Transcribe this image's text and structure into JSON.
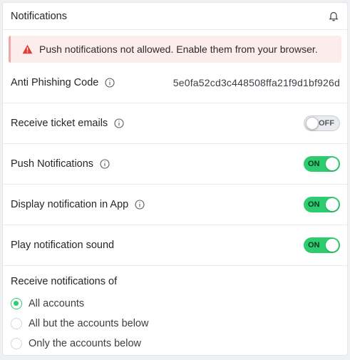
{
  "header": {
    "title": "Notifications",
    "icon": "bell-icon"
  },
  "alert": {
    "text": "Push notifications not allowed. Enable them from your browser.",
    "color": "#e53935"
  },
  "anti_phishing": {
    "label": "Anti Phishing Code",
    "value": "5e0fa52cd3c448508ffa21f9d1bf926d"
  },
  "settings": [
    {
      "label": "Receive ticket emails",
      "state": "OFF"
    },
    {
      "label": "Push Notifications",
      "state": "ON"
    },
    {
      "label": "Display notification in App",
      "state": "ON"
    },
    {
      "label": "Play notification sound",
      "state": "ON"
    }
  ],
  "receive": {
    "heading": "Receive notifications of",
    "options": [
      "All accounts",
      "All but the accounts below",
      "Only the accounts below"
    ],
    "selected": "All accounts"
  },
  "colors": {
    "toggle_on": "#2ecc71",
    "accent": "#2ecc71"
  }
}
